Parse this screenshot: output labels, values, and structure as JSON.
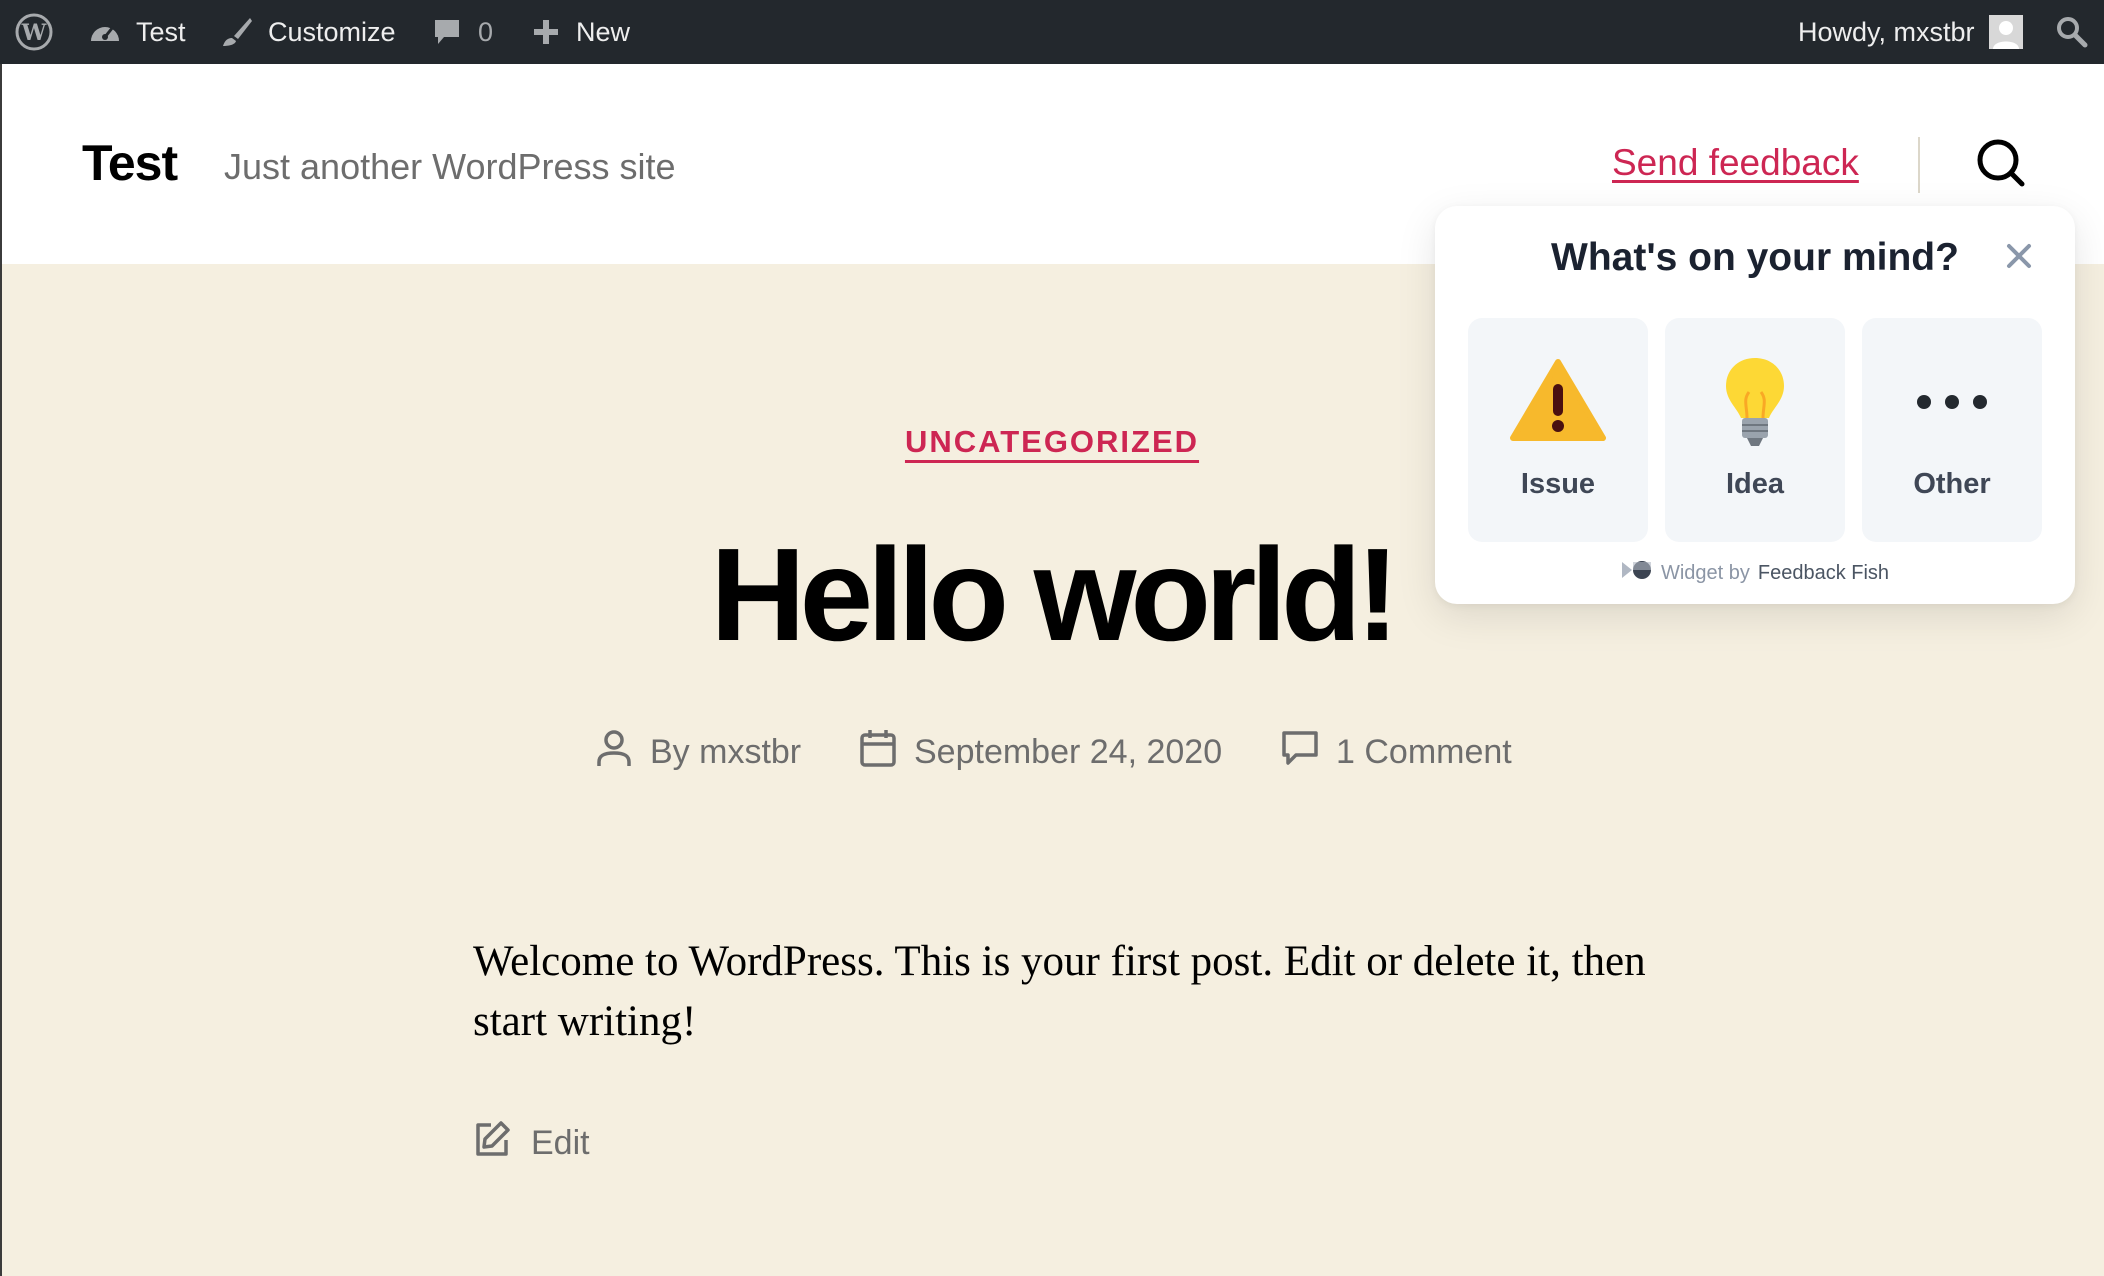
{
  "admin_bar": {
    "site_name": "Test",
    "customize": "Customize",
    "comments_count": "0",
    "new": "New",
    "howdy": "Howdy, mxstbr"
  },
  "header": {
    "site_title": "Test",
    "tagline": "Just another WordPress site",
    "send_feedback": "Send feedback"
  },
  "post": {
    "category": "UNCATEGORIZED",
    "title": "Hello world!",
    "author": "By mxstbr",
    "date": "September 24, 2020",
    "comments": "1 Comment",
    "body": "Welcome to WordPress. This is your first post. Edit or delete it, then start writing!",
    "edit": "Edit"
  },
  "feedback_popup": {
    "title": "What's on your mind?",
    "options": [
      {
        "label": "Issue",
        "icon": "warning-icon"
      },
      {
        "label": "Idea",
        "icon": "lightbulb-icon"
      },
      {
        "label": "Other",
        "icon": "ellipsis-icon"
      }
    ],
    "footer_prefix": "Widget by",
    "footer_brand": "Feedback Fish"
  },
  "colors": {
    "admin_bar_bg": "#23282d",
    "accent": "#cd2653",
    "page_bg": "#f5efe0"
  }
}
